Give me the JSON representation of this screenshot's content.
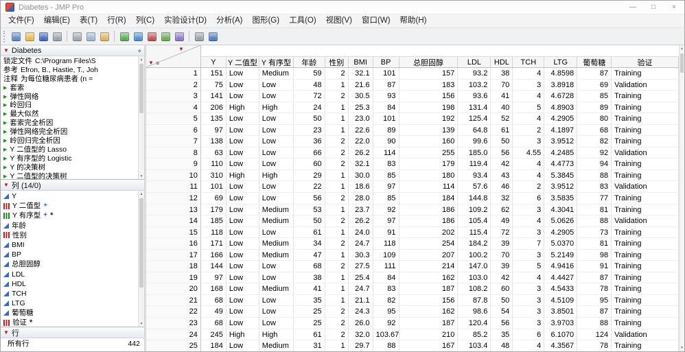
{
  "window": {
    "title": "Diabetes - JMP Pro",
    "controls": {
      "minimize": "—",
      "maximize": "□",
      "close": "×"
    }
  },
  "menubar": {
    "items": [
      "文件(F)",
      "编辑(E)",
      "表(T)",
      "行(R)",
      "列(C)",
      "实验设计(D)",
      "分析(A)",
      "图形(G)",
      "工具(O)",
      "视图(V)",
      "窗口(W)",
      "帮助(H)"
    ]
  },
  "toolbar": {
    "groups": [
      [
        {
          "name": "new-data-table-icon",
          "color": "#5b87c5"
        },
        {
          "name": "open-file-icon",
          "color": "#e3b84e"
        },
        {
          "name": "save-icon",
          "color": "#3d68c0"
        },
        {
          "name": "print-icon",
          "color": "#9aa2ab"
        }
      ],
      [
        {
          "name": "cut-icon",
          "color": "#a0a8b0"
        },
        {
          "name": "copy-icon",
          "color": "#9fb6cc"
        },
        {
          "name": "paste-icon",
          "color": "#d9b45b"
        }
      ],
      [
        {
          "name": "add-rows-icon",
          "color": "#57a857"
        },
        {
          "name": "add-columns-icon",
          "color": "#4a90d0"
        },
        {
          "name": "distribution-icon",
          "color": "#c05050"
        },
        {
          "name": "graph-builder-icon",
          "color": "#67ab4f"
        },
        {
          "name": "data-filter-icon",
          "color": "#8a77c0"
        }
      ],
      [
        {
          "name": "selection-tool-icon",
          "color": "#98a0a8"
        },
        {
          "name": "help-icon",
          "color": "#4a7ebd"
        }
      ]
    ]
  },
  "sidebar": {
    "table_panel": {
      "title": "Diabetes",
      "properties": [
        {
          "label": "锁定文件",
          "value": "C:\\Program Files\\S"
        },
        {
          "label": "参考",
          "value": "Efron, B., Hastie, T., Joh"
        },
        {
          "label": "注释",
          "value": "为每位糖尿病患者 (n ="
        }
      ],
      "scripts": [
        "套索",
        "弹性网络",
        "岭回归",
        "最大似然",
        "套索完全析因",
        "弹性网络完全析因",
        "岭回归完全析因",
        "Y 二值型的 Lasso",
        "Y 有序型的 Logistic",
        "Y 的决策树",
        "Y 二值型的决策树"
      ]
    },
    "columns_panel": {
      "title": "列  (14/0)",
      "items": [
        {
          "name": "Y",
          "type": "continuous",
          "badges": []
        },
        {
          "name": "Y 二值型",
          "type": "nominal",
          "badges": [
            "formula"
          ]
        },
        {
          "name": "Y 有序型",
          "type": "ordinal",
          "badges": [
            "formula",
            "asterisk"
          ]
        },
        {
          "name": "年龄",
          "type": "continuous",
          "badges": []
        },
        {
          "name": "性别",
          "type": "nominal",
          "badges": []
        },
        {
          "name": "BMI",
          "type": "continuous",
          "badges": []
        },
        {
          "name": "BP",
          "type": "continuous",
          "badges": []
        },
        {
          "name": "总胆固醇",
          "type": "continuous",
          "badges": []
        },
        {
          "name": "LDL",
          "type": "continuous",
          "badges": []
        },
        {
          "name": "HDL",
          "type": "continuous",
          "badges": []
        },
        {
          "name": "TCH",
          "type": "continuous",
          "badges": []
        },
        {
          "name": "LTG",
          "type": "continuous",
          "badges": []
        },
        {
          "name": "葡萄糖",
          "type": "continuous",
          "badges": []
        },
        {
          "name": "验证",
          "type": "nominal",
          "badges": [
            "asterisk"
          ]
        }
      ]
    },
    "rows_panel": {
      "title": "行",
      "stats": [
        {
          "label": "所有行",
          "value": "442"
        }
      ]
    }
  },
  "table": {
    "columns": [
      "Y",
      "Y 二值型",
      "Y 有序型",
      "年龄",
      "性别",
      "BMI",
      "BP",
      "总胆固醇",
      "LDL",
      "HDL",
      "TCH",
      "LTG",
      "葡萄糖",
      "验证"
    ],
    "rows": [
      [
        "1",
        "151",
        "Low",
        "Medium",
        "59",
        "2",
        "32.1",
        "101",
        "157",
        "93.2",
        "38",
        "4",
        "4.8598",
        "87",
        "Training"
      ],
      [
        "2",
        "75",
        "Low",
        "Low",
        "48",
        "1",
        "21.6",
        "87",
        "183",
        "103.2",
        "70",
        "3",
        "3.8918",
        "69",
        "Validation"
      ],
      [
        "3",
        "141",
        "Low",
        "Low",
        "72",
        "2",
        "30.5",
        "93",
        "156",
        "93.6",
        "41",
        "4",
        "4.6728",
        "85",
        "Training"
      ],
      [
        "4",
        "206",
        "High",
        "High",
        "24",
        "1",
        "25.3",
        "84",
        "198",
        "131.4",
        "40",
        "5",
        "4.8903",
        "89",
        "Training"
      ],
      [
        "5",
        "135",
        "Low",
        "Low",
        "50",
        "1",
        "23.0",
        "101",
        "192",
        "125.4",
        "52",
        "4",
        "4.2905",
        "80",
        "Training"
      ],
      [
        "6",
        "97",
        "Low",
        "Low",
        "23",
        "1",
        "22.6",
        "89",
        "139",
        "64.8",
        "61",
        "2",
        "4.1897",
        "68",
        "Training"
      ],
      [
        "7",
        "138",
        "Low",
        "Low",
        "36",
        "2",
        "22.0",
        "90",
        "160",
        "99.6",
        "50",
        "3",
        "3.9512",
        "82",
        "Training"
      ],
      [
        "8",
        "63",
        "Low",
        "Low",
        "66",
        "2",
        "26.2",
        "114",
        "255",
        "185.0",
        "56",
        "4.55",
        "4.2485",
        "92",
        "Validation"
      ],
      [
        "9",
        "110",
        "Low",
        "Low",
        "60",
        "2",
        "32.1",
        "83",
        "179",
        "119.4",
        "42",
        "4",
        "4.4773",
        "94",
        "Training"
      ],
      [
        "10",
        "310",
        "High",
        "High",
        "29",
        "1",
        "30.0",
        "85",
        "180",
        "93.4",
        "43",
        "4",
        "5.3845",
        "88",
        "Training"
      ],
      [
        "11",
        "101",
        "Low",
        "Low",
        "22",
        "1",
        "18.6",
        "97",
        "114",
        "57.6",
        "46",
        "2",
        "3.9512",
        "83",
        "Validation"
      ],
      [
        "12",
        "69",
        "Low",
        "Low",
        "56",
        "2",
        "28.0",
        "85",
        "184",
        "144.8",
        "32",
        "6",
        "3.5835",
        "77",
        "Training"
      ],
      [
        "13",
        "179",
        "Low",
        "Medium",
        "53",
        "1",
        "23.7",
        "92",
        "186",
        "109.2",
        "62",
        "3",
        "4.3041",
        "81",
        "Training"
      ],
      [
        "14",
        "185",
        "Low",
        "Medium",
        "50",
        "2",
        "26.2",
        "97",
        "186",
        "105.4",
        "49",
        "4",
        "5.0626",
        "88",
        "Validation"
      ],
      [
        "15",
        "118",
        "Low",
        "Low",
        "61",
        "1",
        "24.0",
        "91",
        "202",
        "115.4",
        "72",
        "3",
        "4.2905",
        "73",
        "Training"
      ],
      [
        "16",
        "171",
        "Low",
        "Medium",
        "34",
        "2",
        "24.7",
        "118",
        "254",
        "184.2",
        "39",
        "7",
        "5.0370",
        "81",
        "Training"
      ],
      [
        "17",
        "166",
        "Low",
        "Medium",
        "47",
        "1",
        "30.3",
        "109",
        "207",
        "100.2",
        "70",
        "3",
        "5.2149",
        "98",
        "Training"
      ],
      [
        "18",
        "144",
        "Low",
        "Low",
        "68",
        "2",
        "27.5",
        "111",
        "214",
        "147.0",
        "39",
        "5",
        "4.9416",
        "91",
        "Training"
      ],
      [
        "19",
        "97",
        "Low",
        "Low",
        "38",
        "1",
        "25.4",
        "84",
        "162",
        "103.0",
        "42",
        "4",
        "4.4427",
        "87",
        "Training"
      ],
      [
        "20",
        "168",
        "Low",
        "Medium",
        "41",
        "1",
        "24.7",
        "83",
        "187",
        "108.2",
        "60",
        "3",
        "4.5433",
        "78",
        "Training"
      ],
      [
        "21",
        "68",
        "Low",
        "Low",
        "35",
        "1",
        "21.1",
        "82",
        "156",
        "87.8",
        "50",
        "3",
        "4.5109",
        "95",
        "Training"
      ],
      [
        "22",
        "49",
        "Low",
        "Low",
        "25",
        "2",
        "24.3",
        "95",
        "162",
        "98.6",
        "54",
        "3",
        "3.8501",
        "87",
        "Training"
      ],
      [
        "23",
        "68",
        "Low",
        "Low",
        "25",
        "2",
        "26.0",
        "92",
        "187",
        "120.4",
        "56",
        "3",
        "3.9703",
        "88",
        "Training"
      ],
      [
        "24",
        "245",
        "High",
        "High",
        "61",
        "2",
        "32.0",
        "103.67",
        "210",
        "85.2",
        "35",
        "6",
        "6.1070",
        "124",
        "Validation"
      ],
      [
        "25",
        "184",
        "Low",
        "Medium",
        "31",
        "1",
        "29.7",
        "88",
        "167",
        "103.4",
        "48",
        "4",
        "4.3567",
        "78",
        "Training"
      ]
    ]
  }
}
